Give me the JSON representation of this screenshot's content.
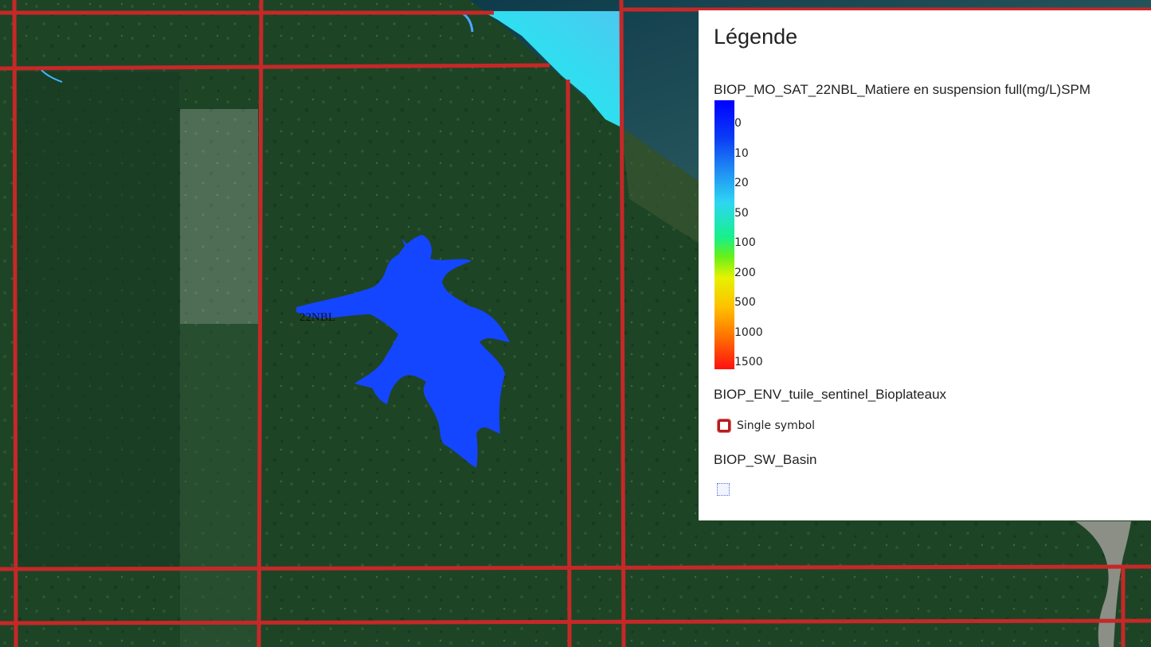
{
  "map": {
    "tile_label": "22NBL",
    "grid_color": "#c62828",
    "water_color": "#1446ff"
  },
  "legend": {
    "title": "Légende",
    "layers": [
      {
        "name": "BIOP_MO_SAT_22NBL_Matiere en suspension full(mg/L)SPM",
        "type": "color-ramp",
        "ramp_labels": [
          "0",
          "10",
          "20",
          "50",
          "100",
          "200",
          "500",
          "1000",
          "1500"
        ],
        "ramp_colors": [
          "#0000ff",
          "#1f8cf3",
          "#2ed6f2",
          "#17f08a",
          "#e6f200",
          "#ffc000",
          "#ff7800",
          "#ff1010"
        ]
      },
      {
        "name": "BIOP_ENV_tuile_sentinel_Bioplateaux",
        "type": "single-symbol",
        "symbol_label": "Single symbol",
        "symbol_color": "#b71c1c"
      },
      {
        "name": "BIOP_SW_Basin",
        "type": "polygon",
        "symbol_color": "#5b6cf0"
      }
    ]
  }
}
